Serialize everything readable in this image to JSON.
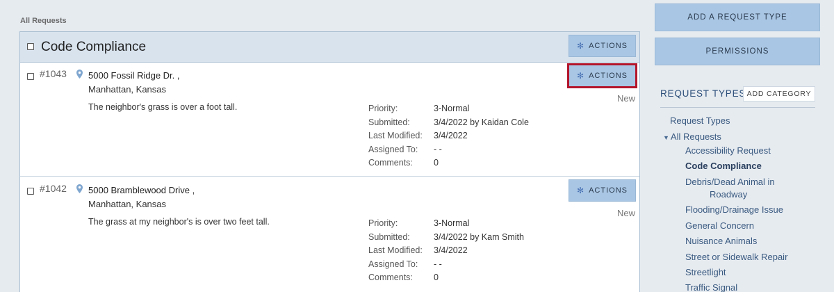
{
  "breadcrumb": "All Requests",
  "panel": {
    "title": "Code Compliance",
    "actions_label": "ACTIONS"
  },
  "requests": [
    {
      "number": "#1043",
      "address_line1": "5000 Fossil Ridge Dr. ,",
      "address_line2": "Manhattan, Kansas",
      "description": "The neighbor's grass is over a foot tall.",
      "status": "New",
      "actions_label": "ACTIONS",
      "meta_labels": [
        "Priority:",
        "Submitted:",
        "Last Modified:",
        "Assigned To:",
        "Comments:"
      ],
      "priority": "3-Normal",
      "submitted": "3/4/2022 by Kaidan Cole",
      "last_modified": "3/4/2022",
      "assigned_to": "- -",
      "comments": "0"
    },
    {
      "number": "#1042",
      "address_line1": "5000 Bramblewood Drive ,",
      "address_line2": "Manhattan, Kansas",
      "description": "The grass at my neighbor's is over two feet tall.",
      "status": "New",
      "actions_label": "ACTIONS",
      "meta_labels": [
        "Priority:",
        "Submitted:",
        "Last Modified:",
        "Assigned To:",
        "Comments:"
      ],
      "priority": "3-Normal",
      "submitted": "3/4/2022 by Kam Smith",
      "last_modified": "3/4/2022",
      "assigned_to": "- -",
      "comments": "0"
    }
  ],
  "sidebar": {
    "add_request_type": "ADD A REQUEST TYPE",
    "permissions": "PERMISSIONS",
    "request_types_heading": "REQUEST TYPES",
    "add_category": "ADD CATEGORY",
    "tree": {
      "root": "Request Types",
      "group": "All Requests",
      "items": [
        "Accessibility Request",
        "Code Compliance",
        "Debris/Dead Animal in",
        "Roadway",
        "Flooding/Drainage Issue",
        "General Concern",
        "Nuisance Animals",
        "Street or Sidewalk Repair",
        "Streetlight",
        "Traffic Signal"
      ]
    }
  },
  "colors": {
    "accent_button": "#a9c6e4",
    "highlight_outline": "#b3152b",
    "link": "#3a5a80"
  },
  "icons": {
    "gear": "gear-icon",
    "pin": "map-pin-icon",
    "tree_expand": "triangle-down-icon"
  }
}
